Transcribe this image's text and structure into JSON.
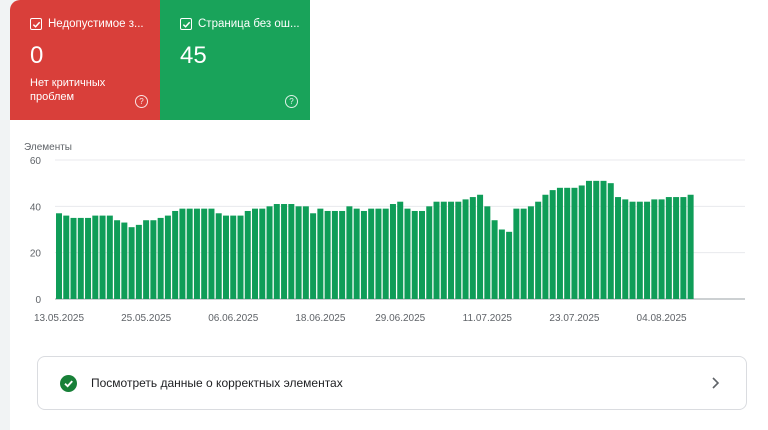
{
  "tiles": [
    {
      "label": "Недопустимое з...",
      "value": "0",
      "sub": "Нет критичных проблем",
      "color": "#d93f3a"
    },
    {
      "label": "Страница без ош...",
      "value": "45",
      "sub": "",
      "color": "#19a35a"
    }
  ],
  "help_symbol": "?",
  "chart_data": {
    "type": "bar",
    "ylabel": "Элементы",
    "ylim": [
      0,
      60
    ],
    "yticks": [
      0,
      20,
      40,
      60
    ],
    "xtick_labels": [
      "13.05.2025",
      "25.05.2025",
      "06.06.2025",
      "18.06.2025",
      "29.06.2025",
      "11.07.2025",
      "23.07.2025",
      "04.08.2025"
    ],
    "xtick_index": [
      0,
      12,
      24,
      36,
      47,
      59,
      71,
      83
    ],
    "bar_color": "#0f9d58",
    "values": [
      37,
      36,
      35,
      35,
      35,
      36,
      36,
      36,
      34,
      33,
      31,
      32,
      34,
      34,
      35,
      36,
      38,
      39,
      39,
      39,
      39,
      39,
      37,
      36,
      36,
      36,
      38,
      39,
      39,
      40,
      41,
      41,
      41,
      40,
      40,
      37,
      39,
      38,
      38,
      38,
      40,
      39,
      38,
      39,
      39,
      39,
      41,
      42,
      39,
      38,
      38,
      40,
      42,
      42,
      42,
      42,
      43,
      44,
      45,
      40,
      34,
      30,
      29,
      39,
      39,
      40,
      42,
      45,
      47,
      48,
      48,
      48,
      49,
      51,
      51,
      51,
      50,
      44,
      43,
      42,
      42,
      42,
      43,
      43,
      44,
      44,
      44,
      45
    ]
  },
  "link": {
    "label": "Посмотреть данные о корректных элементах"
  }
}
